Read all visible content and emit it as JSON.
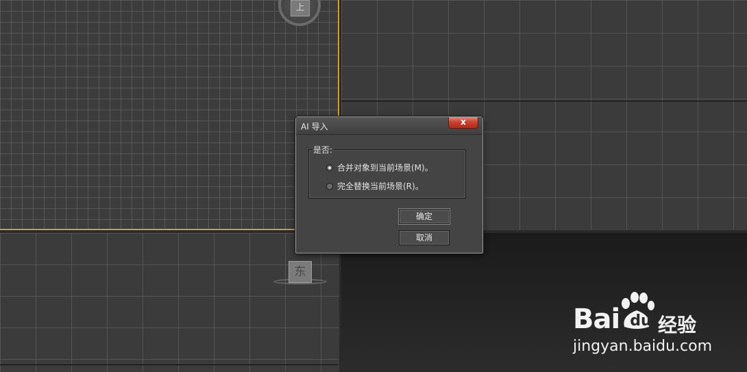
{
  "viewports": {
    "top_cube_label": "上",
    "left_cube_label": "东"
  },
  "dialog": {
    "title": "AI 导入",
    "close_label": "x",
    "group_label": "是否:",
    "options": [
      {
        "label": "合并对象到当前场景(M)。",
        "checked": true
      },
      {
        "label": "完全替换当前场景(R)。",
        "checked": false
      }
    ],
    "ok_label": "确定",
    "cancel_label": "取消"
  },
  "watermark": {
    "brand": "Bai",
    "du": "du",
    "suffix": "经验",
    "url": "jingyan.baidu.com"
  },
  "colors": {
    "accent_border": "#c8a04a",
    "close_red": "#c84332"
  }
}
